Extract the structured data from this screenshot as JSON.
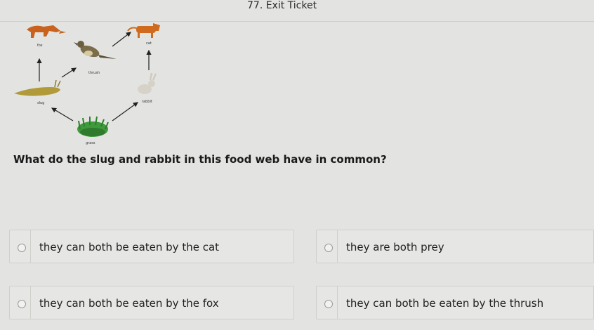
{
  "header": {
    "title": "77. Exit Ticket"
  },
  "food_web": {
    "labels": {
      "fox": "fox",
      "cat": "cat",
      "thrush": "thrush",
      "slug": "slug",
      "rabbit": "rabbit",
      "grass": "grass"
    }
  },
  "question": {
    "text": "What do the slug and rabbit in this food web have in common?"
  },
  "choices": [
    {
      "label": "they can both be eaten by the cat"
    },
    {
      "label": "they are both prey"
    },
    {
      "label": "they can both be eaten by the fox"
    },
    {
      "label": "they can both be eaten by the thrush"
    }
  ]
}
